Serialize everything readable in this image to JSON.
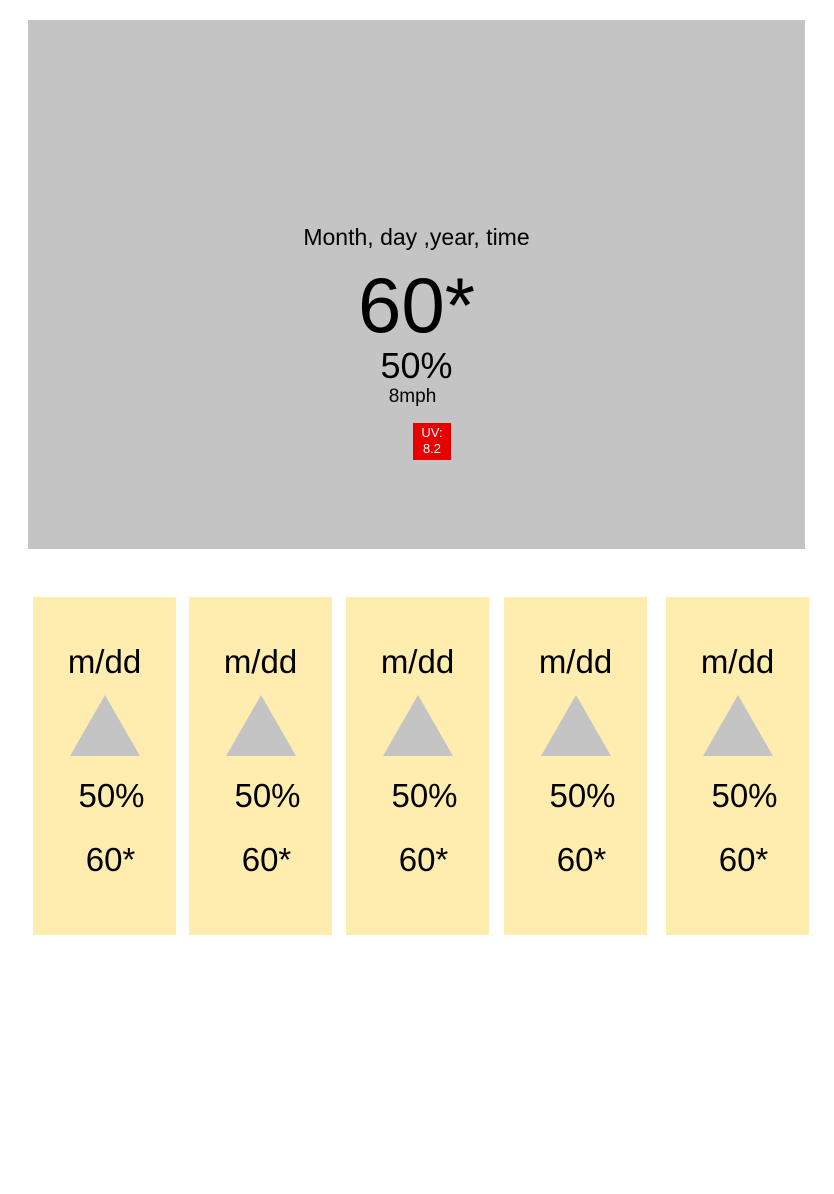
{
  "current": {
    "datetime": "Month, day ,year, time",
    "temperature": "60*",
    "humidity": "50%",
    "wind": "8mph",
    "uv": {
      "label": "UV:",
      "value": "8.2",
      "background": "#e60000",
      "text_color": "#ffffff"
    }
  },
  "colors": {
    "panel_background": "#c4c4c4",
    "card_background": "#ffedb0",
    "icon_fill": "#c4c4c4"
  },
  "forecast": [
    {
      "date": "m/dd",
      "icon": "triangle-weather-icon",
      "humidity": "50%",
      "temperature": "60*"
    },
    {
      "date": "m/dd",
      "icon": "triangle-weather-icon",
      "humidity": "50%",
      "temperature": "60*"
    },
    {
      "date": "m/dd",
      "icon": "triangle-weather-icon",
      "humidity": "50%",
      "temperature": "60*"
    },
    {
      "date": "m/dd",
      "icon": "triangle-weather-icon",
      "humidity": "50%",
      "temperature": "60*"
    },
    {
      "date": "m/dd",
      "icon": "triangle-weather-icon",
      "humidity": "50%",
      "temperature": "60*"
    }
  ]
}
